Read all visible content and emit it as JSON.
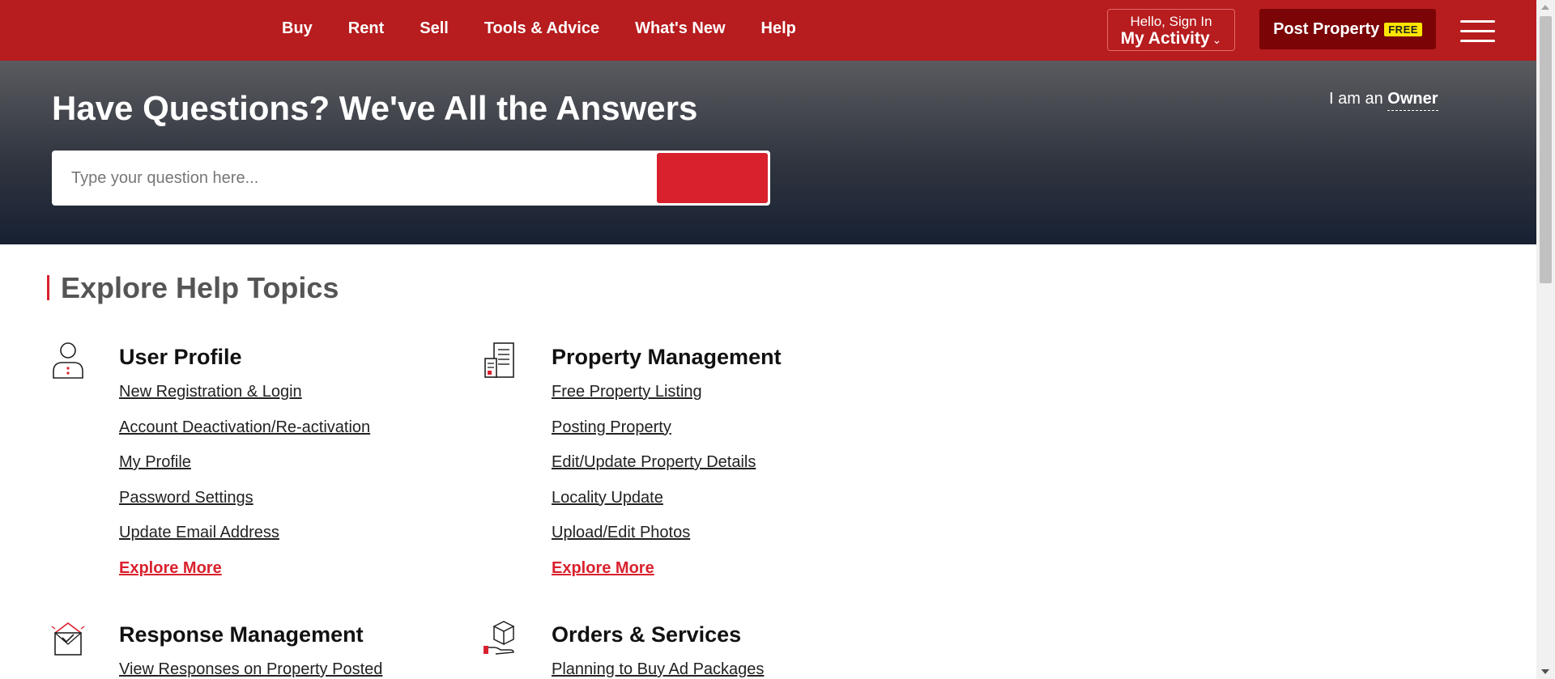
{
  "nav": {
    "items": [
      "Buy",
      "Rent",
      "Sell",
      "Tools & Advice",
      "What's New",
      "Help"
    ],
    "signin_line1": "Hello, Sign In",
    "signin_line2": "My Activity",
    "post_label": "Post Property",
    "post_badge": "FREE",
    "brand_color": "#b71c1e"
  },
  "hero": {
    "title_strong": "Have Questions?",
    "title_rest": "We've All the Answers",
    "role_prefix": "I am an",
    "role_value": "Owner",
    "search_placeholder": "Type your question here..."
  },
  "main": {
    "section_title": "Explore Help Topics",
    "topics": [
      {
        "title": "User Profile",
        "icon": "user-icon",
        "links": [
          "New Registration & Login",
          "Account Deactivation/Re-activation",
          "My Profile",
          "Password Settings",
          "Update Email Address"
        ],
        "more": "Explore More"
      },
      {
        "title": "Property Management",
        "icon": "property-document-icon",
        "links": [
          "Free Property Listing",
          "Posting Property",
          "Edit/Update Property Details",
          "Locality Update",
          "Upload/Edit Photos"
        ],
        "more": "Explore More"
      },
      {
        "title": "Response Management",
        "icon": "envelope-check-icon",
        "links": [
          "View Responses on Property Posted"
        ]
      },
      {
        "title": "Orders & Services",
        "icon": "package-hand-icon",
        "links": [
          "Planning to Buy Ad Packages"
        ]
      }
    ]
  },
  "accent_color": "#d9212d"
}
